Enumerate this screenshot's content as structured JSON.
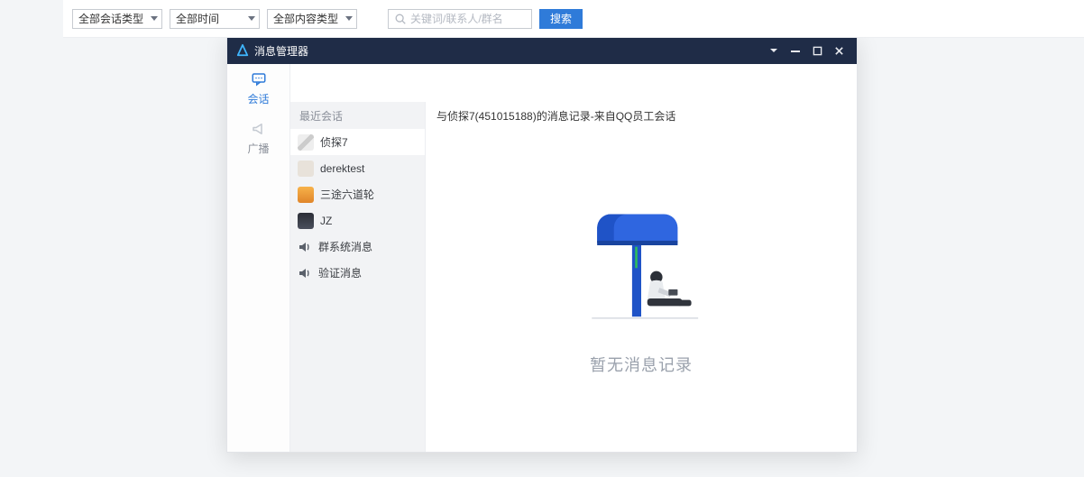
{
  "window": {
    "title": "消息管理器"
  },
  "nav": {
    "items": [
      {
        "key": "chat",
        "label": "会话"
      },
      {
        "key": "broadcast",
        "label": "广播"
      }
    ]
  },
  "toolbar": {
    "filter_type": "全部会话类型",
    "filter_time": "全部时间",
    "filter_content": "全部内容类型",
    "search_placeholder": "关键词/联系人/群名",
    "search_button": "搜索"
  },
  "list": {
    "header": "最近会话",
    "items": [
      {
        "name": "侦探7",
        "icon": "avatar"
      },
      {
        "name": "derektest",
        "icon": "avatar"
      },
      {
        "name": "三途六道轮",
        "icon": "avatar"
      },
      {
        "name": "JZ",
        "icon": "avatar"
      },
      {
        "name": "群系统消息",
        "icon": "speaker"
      },
      {
        "name": "验证消息",
        "icon": "speaker"
      }
    ]
  },
  "detail": {
    "title": "与侦探7(451015188)的消息记录-来自QQ员工会话",
    "empty_text": "暂无消息记录"
  }
}
